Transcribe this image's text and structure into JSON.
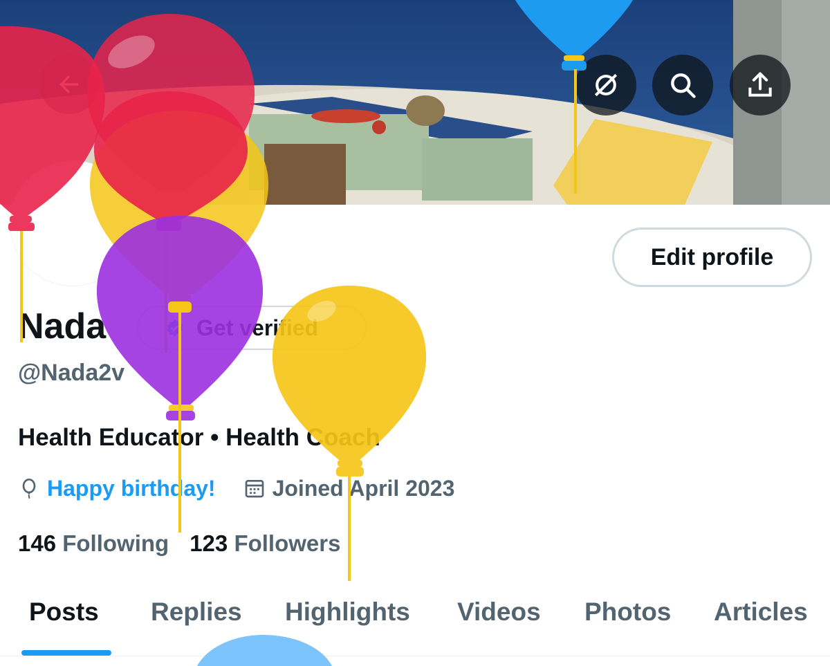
{
  "profile": {
    "name": "Nada",
    "handle": "@Nada2v",
    "bio": "Health Educator • Health Coach",
    "birthday": "Happy birthday!",
    "joined": "Joined April 2023",
    "following_count": "146",
    "following_label": "Following",
    "followers_count": "123",
    "followers_label": "Followers"
  },
  "buttons": {
    "edit_profile": "Edit profile",
    "get_verified": "Get verified"
  },
  "icons": {
    "back": "back-arrow-icon",
    "grok": "grok-icon",
    "search": "search-icon",
    "share": "share-icon",
    "balloon": "balloon-icon",
    "calendar": "calendar-icon",
    "verified": "verified-badge-icon"
  },
  "tabs": [
    {
      "label": "Posts",
      "active": true
    },
    {
      "label": "Replies",
      "active": false
    },
    {
      "label": "Highlights",
      "active": false
    },
    {
      "label": "Videos",
      "active": false
    },
    {
      "label": "Photos",
      "active": false
    },
    {
      "label": "Articles",
      "active": false
    }
  ],
  "colors": {
    "accent": "#1d9bf0",
    "text_primary": "#0f1419",
    "text_secondary": "#536471",
    "balloon_red": "#e8234a",
    "balloon_yellow": "#f5c518",
    "balloon_purple": "#9b30e0",
    "balloon_blue": "#1d9bf0"
  }
}
